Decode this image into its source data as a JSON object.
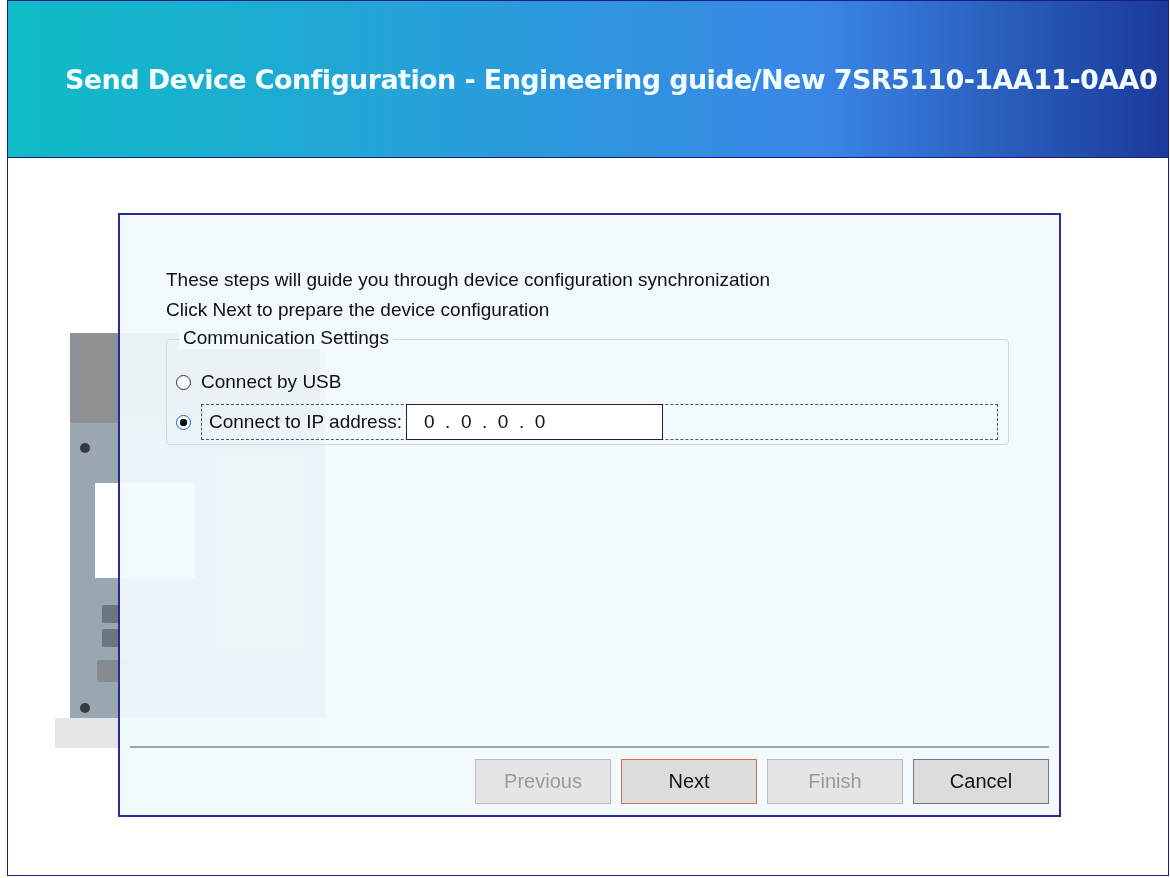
{
  "window": {
    "title": "Send Device Configuration - Engineering guide/New 7SR5110-1AA11-0AA0"
  },
  "intro": [
    "These steps will guide you through device configuration synchronization",
    "Click Next to prepare the device configuration"
  ],
  "communication_settings": {
    "label": "Communication Settings",
    "options": [
      {
        "label": "Connect by USB",
        "selected": false,
        "kind": "plain"
      },
      {
        "label": "Connect to IP address:",
        "selected": true,
        "kind": "ip"
      }
    ],
    "ip_address": {
      "value": "0  .  0  .  0  .  0"
    }
  },
  "buttons": [
    {
      "label": "Previous",
      "disabled": true,
      "default": false
    },
    {
      "label": "Next",
      "disabled": false,
      "default": true
    },
    {
      "label": "Finish",
      "disabled": true,
      "default": false
    },
    {
      "label": "Cancel",
      "disabled": false,
      "default": false
    }
  ]
}
